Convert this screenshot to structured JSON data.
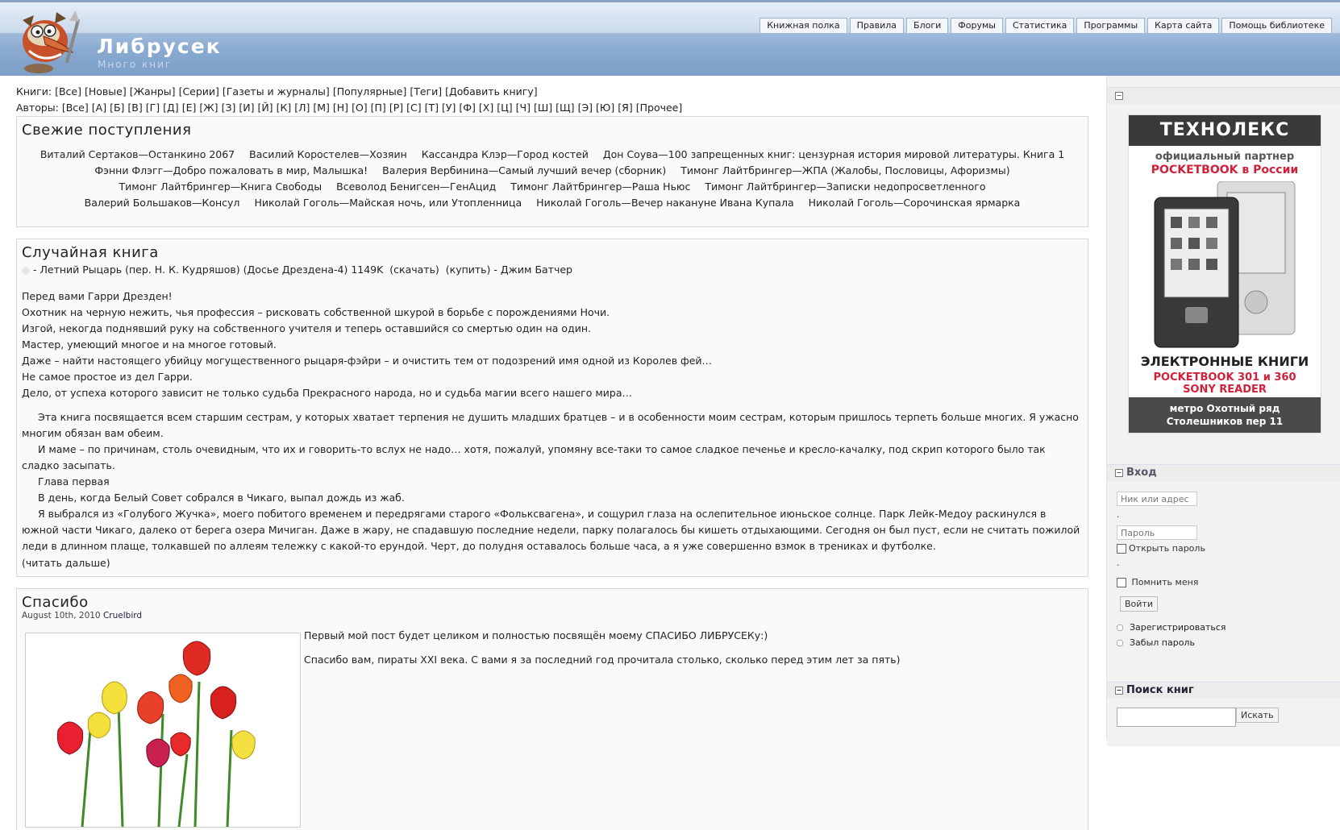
{
  "header": {
    "site_name": "Либрусек",
    "slogan": "Много книг",
    "nav": [
      "Книжная полка",
      "Правила",
      "Блоги",
      "Форумы",
      "Статистика",
      "Программы",
      "Карта сайта",
      "Помощь библиотеке"
    ]
  },
  "book_links": {
    "label": "Книги:",
    "items": [
      "[Все]",
      "[Новые]",
      "[Жанры]",
      "[Серии]",
      "[Газеты и журналы]",
      "[Популярные]",
      "[Теги]",
      "[Добавить книгу]"
    ]
  },
  "author_links": {
    "label": "Авторы:",
    "items": [
      "[Все]",
      "[А]",
      "[Б]",
      "[В]",
      "[Г]",
      "[Д]",
      "[Е]",
      "[Ж]",
      "[З]",
      "[И]",
      "[Й]",
      "[К]",
      "[Л]",
      "[М]",
      "[Н]",
      "[О]",
      "[П]",
      "[Р]",
      "[С]",
      "[Т]",
      "[У]",
      "[Ф]",
      "[Х]",
      "[Ц]",
      "[Ч]",
      "[Ш]",
      "[Щ]",
      "[Э]",
      "[Ю]",
      "[Я]",
      "[Прочее]"
    ]
  },
  "fresh": {
    "title": "Свежие поступления",
    "items": [
      "Виталий Сертаков—Останкино 2067",
      "Василий Коростелев—Хозяин",
      "Кассандра Клэр—Город костей",
      "Дон Соува—100 запрещенных книг: цензурная история мировой литературы. Книга 1",
      "Фэнни Флэгг—Добро пожаловать в мир, Малышка!",
      "Валерия Вербинина—Самый лучший вечер (сборник)",
      "Тимонг Лайтбрингер—ЖПА (Жалобы, Пословицы, Афоризмы)",
      "Тимонг Лайтбрингер—Книга Свободы",
      "Всеволод Бенигсен—ГенАцид",
      "Тимонг Лайтбрингер—Раша Ньюс",
      "Тимонг Лайтбрингер—Записки недопросветленного",
      "Валерий Большаков—Консул",
      "Николай Гоголь—Майская ночь, или Утопленница",
      "Николай Гоголь—Вечер накануне Ивана Купала",
      "Николай Гоголь—Сорочинская ярмарка"
    ]
  },
  "random": {
    "title": "Случайная книга",
    "book_title": "- Летний Рыцарь (пер. Н. К. Кудряшов)",
    "series": "(Досье Дрездена-4)",
    "size": "1149K",
    "download": "(скачать)",
    "buy": "(купить)",
    "author": "- Джим Батчер",
    "annotation": [
      "Перед вами Гарри Дрезден!",
      "Охотник на черную нежить, чья профессия – рисковать собственной шкурой в борьбе с порождениями Ночи.",
      "Изгой, некогда поднявший руку на собственного учителя и теперь оставшийся со смертью один на один.",
      "Мастер, умеющий многое и на многое готовый.",
      "Даже – найти настоящего убийцу могущественного рыцаря-фэйри – и очистить тем от подозрений имя одной из Королев фей…",
      "Не самое простое из дел Гарри.",
      "Дело, от успеха которого зависит не только судьба Прекрасного народа, но и судьба магии всего нашего мира…"
    ],
    "excerpt": [
      "Эта книга посвящается всем старшим сестрам, у которых хватает терпения не душить младших братцев – и в особенности моим сестрам, которым пришлось терпеть больше многих. Я ужасно многим обязан вам обеим.",
      "И маме – по причинам, столь очевидным, что их и говорить-то вслух не надо… хотя, пожалуй, упомяну все-таки то самое сладкое печенье и кресло-качалку, под скрип которого было так сладко засыпать.",
      "Глава первая",
      "В день, когда Белый Совет собрался в Чикаго, выпал дождь из жаб.",
      "Я выбрался из «Голубого Жучка», моего побитого временем и передрягами старого «Фольксвагена», и сощурил глаза на ослепительное июньское солнце. Парк Лейк-Медоу раскинулся в южной части Чикаго, далеко от берега озера Мичиган. Даже в жару, не спадавшую последние недели, парку полагалось бы кишеть отдыхающими. Сегодня он был пуст, если не считать пожилой леди в длинном плаще, толкавшей по аллеям тележку с какой-то ерундой. Черт, до полудня оставалось больше часа, а я уже совершенно взмок в трениках и футболке."
    ],
    "read_more": "(читать дальше)"
  },
  "post": {
    "title": "Спасибо",
    "date": "August 10th, 2010",
    "author": "Cruelbird",
    "paragraphs": [
      "Первый мой пост будет целиком и полностью посвящён моему СПАСИБО ЛИБРУСЕКу:)",
      "Спасибо вам, пираты XXI века. С вами я за последний год прочитала столько, сколько перед этим лет за пять)"
    ]
  },
  "sidebar": {
    "ad": {
      "brand": "ТЕХНОЛЕКС",
      "partner_line1": "официальный партнер",
      "partner_line2": "POCKETBOOK в России",
      "title": "ЭЛЕКТРОННЫЕ КНИГИ",
      "models": "POCKETBOOK 301 и 360",
      "sony": "SONY READER",
      "footer_line1": "метро Охотный ряд",
      "footer_line2": "Столешников пер 11"
    },
    "login": {
      "title": "Вход",
      "username_placeholder": "Ник или адрес",
      "password_placeholder": "Пароль",
      "show_password": "Открыть пароль",
      "remember_me": "Помнить меня",
      "submit": "Войти",
      "register": "Зарегистрироваться",
      "forgot": "Забыл пароль"
    },
    "search": {
      "title": "Поиск книг",
      "button": "Искать"
    }
  },
  "colors": {
    "header_blue": "#7b9ec8",
    "link_text": "#222222",
    "ad_red": "#d0213a"
  }
}
